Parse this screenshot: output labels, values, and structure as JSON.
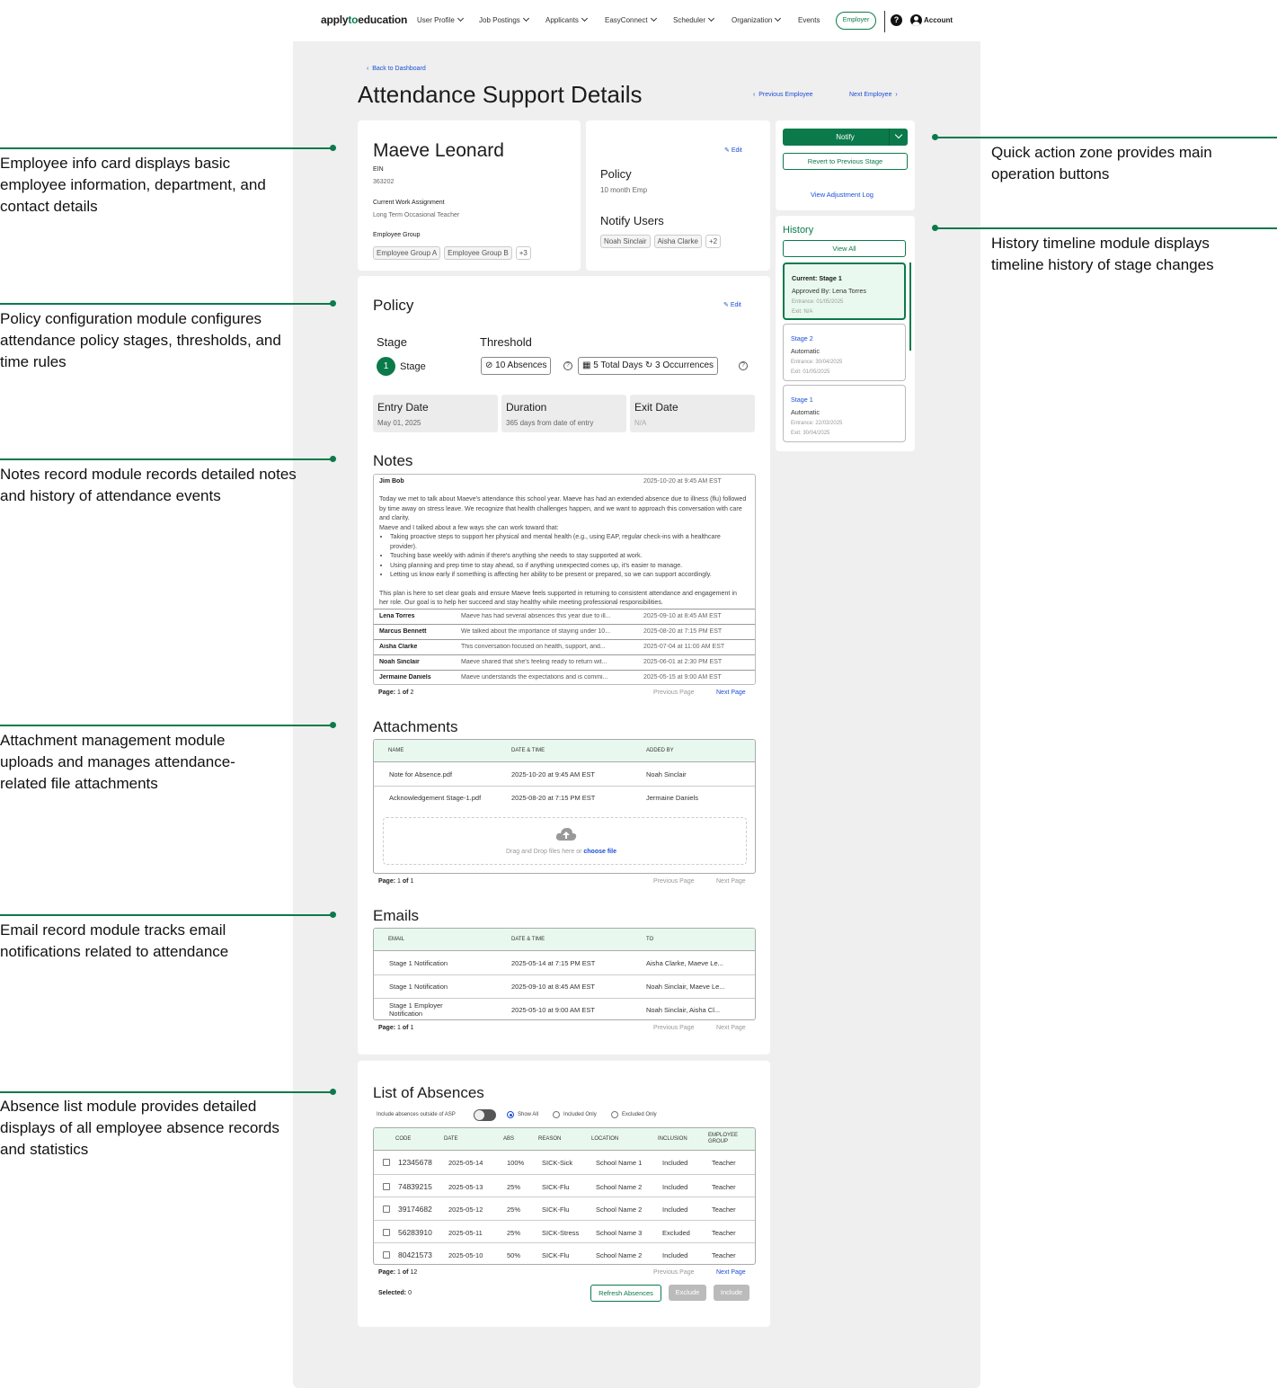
{
  "nav": {
    "brand_pre": "apply",
    "brand_to": "to",
    "brand_post": "education",
    "items": [
      "User Profile",
      "Job Postings",
      "Applicants",
      "EasyConnect",
      "Scheduler",
      "Organization",
      "Events"
    ],
    "employer": "Employer",
    "help": "?",
    "account": "Account"
  },
  "header": {
    "back": "Back to Dashboard",
    "title": "Attendance Support Details",
    "prev": "Previous Employee",
    "next": "Next Employee"
  },
  "employee": {
    "name": "Maeve Leonard",
    "ein_label": "EIN",
    "ein": "363202",
    "assign_label": "Current Work Assignment",
    "assign": "Long Term Occasional Teacher",
    "group_label": "Employee Group",
    "groups": [
      "Employee Group A",
      "Employee Group B"
    ],
    "more": "+3"
  },
  "policy_card": {
    "edit": "Edit",
    "policy_label": "Policy",
    "policy": "10 month Emp",
    "notify_label": "Notify Users",
    "users": [
      "Noah Sinclair",
      "Aisha Clarke"
    ],
    "more": "+2"
  },
  "policy": {
    "title": "Policy",
    "edit": "Edit",
    "stage_label": "Stage",
    "stage_num": "1",
    "stage_text": "Stage",
    "threshold_label": "Threshold",
    "absences": "10 Absences",
    "days": "5 Total Days",
    "occ": "3 Occurrences",
    "entry_label": "Entry Date",
    "entry": "May 01, 2025",
    "duration_label": "Duration",
    "duration": "365 days from date of entry",
    "exit_label": "Exit Date",
    "exit": "N/A"
  },
  "notes": {
    "title": "Notes",
    "first": {
      "author": "Jim Bob",
      "date": "2025-10-20 at 9:45 AM EST",
      "p1": "Today we met to talk about Maeve's attendance this school year. Maeve has had an extended absence due to illness (flu) followed by time away on stress leave. We recognize that health challenges happen, and we want to approach this conversation with care and clarity.",
      "p2": "Maeve and I talked about a few ways she can work toward that:",
      "bullets": [
        "Taking proactive steps to support her physical and mental health (e.g., using EAP, regular check-ins with a healthcare provider).",
        "Touching base weekly with admin if there's anything she needs to stay supported at work.",
        "Using planning and prep time to stay ahead, so if anything unexpected comes up, it's easier to manage.",
        "Letting us know early if something is affecting her ability to be present or prepared, so we can support accordingly."
      ],
      "p3": "This plan is here to set clear goals and ensure Maeve feels supported in returning to consistent attendance and engagement in her role. Our goal is to help her succeed and stay healthy while meeting professional responsibilities."
    },
    "rows": [
      {
        "name": "Lena Torres",
        "text": "Maeve has had several absences this year due to ill...",
        "date": "2025-09-10 at 8:45 AM EST"
      },
      {
        "name": "Marcus Bennett",
        "text": "We talked about the importance of staying under 10...",
        "date": "2025-08-20 at 7:15 PM EST"
      },
      {
        "name": "Aisha Clarke",
        "text": "This conversation focused on health, support, and...",
        "date": "2025-07-04 at 11:00 AM EST"
      },
      {
        "name": "Noah Sinclair",
        "text": "Maeve shared that she's feeling ready to return wit...",
        "date": "2025-06-01 at 2:30 PM EST"
      },
      {
        "name": "Jermaine Daniels",
        "text": "Maeve understands the expectations and is commi...",
        "date": "2025-05-15 at 9:00 AM EST"
      }
    ],
    "page_label": "Page:",
    "page": "1",
    "of": "of",
    "total": "2",
    "prev": "Previous Page",
    "next": "Next Page"
  },
  "attachments": {
    "title": "Attachments",
    "cols": [
      "NAME",
      "DATE & TIME",
      "ADDED BY"
    ],
    "rows": [
      {
        "name": "Note for Absence.pdf",
        "date": "2025-10-20 at 9:45 AM EST",
        "by": "Noah Sinclair"
      },
      {
        "name": "Acknowledgement Stage-1.pdf",
        "date": "2025-08-20 at 7:15 PM EST",
        "by": "Jermaine Daniels"
      }
    ],
    "drop": "Drag and Drop files here or",
    "choose": "choose file",
    "page_label": "Page:",
    "page": "1",
    "of": "of",
    "total": "1",
    "prev": "Previous Page",
    "next": "Next Page"
  },
  "emails": {
    "title": "Emails",
    "cols": [
      "EMAIL",
      "DATE & TIME",
      "TO"
    ],
    "rows": [
      {
        "name": "Stage 1 Notification",
        "date": "2025-05-14 at 7:15 PM EST",
        "to": "Aisha Clarke, Maeve Le..."
      },
      {
        "name": "Stage 1 Notification",
        "date": "2025-09-10 at 8:45 AM EST",
        "to": "Noah Sinclair, Maeve Le..."
      },
      {
        "name": "Stage 1 Employer Notification",
        "date": "2025-05-10 at 9:00 AM EST",
        "to": "Noah Sinclair, Aisha Cl..."
      }
    ],
    "page_label": "Page:",
    "page": "1",
    "of": "of",
    "total": "1",
    "prev": "Previous Page",
    "next": "Next Page"
  },
  "absences": {
    "title": "List of Absences",
    "toggle_label": "Include absences outside of ASP",
    "show_all": "Show All",
    "included_only": "Included Only",
    "excluded_only": "Excluded Only",
    "cols": [
      "CODE",
      "DATE",
      "ABS",
      "REASON",
      "LOCATION",
      "INCLUSION",
      "EMPLOYEE GROUP"
    ],
    "rows": [
      {
        "code": "12345678",
        "date": "2025-05-14",
        "abs": "100%",
        "reason": "SICK-Sick",
        "loc": "School Name 1",
        "inc": "Included",
        "grp": "Teacher"
      },
      {
        "code": "74839215",
        "date": "2025-05-13",
        "abs": "25%",
        "reason": "SICK-Flu",
        "loc": "School Name 2",
        "inc": "Included",
        "grp": "Teacher"
      },
      {
        "code": "39174682",
        "date": "2025-05-12",
        "abs": "25%",
        "reason": "SICK-Flu",
        "loc": "School Name 2",
        "inc": "Included",
        "grp": "Teacher"
      },
      {
        "code": "56283910",
        "date": "2025-05-11",
        "abs": "25%",
        "reason": "SICK-Stress",
        "loc": "School Name 3",
        "inc": "Excluded",
        "grp": "Teacher"
      },
      {
        "code": "80421573",
        "date": "2025-05-10",
        "abs": "50%",
        "reason": "SICK-Flu",
        "loc": "School Name 2",
        "inc": "Included",
        "grp": "Teacher"
      }
    ],
    "page_label": "Page:",
    "page": "1",
    "of": "of",
    "total": "12",
    "prev": "Previous Page",
    "next": "Next Page",
    "selected_label": "Selected:",
    "selected": "0",
    "refresh": "Refresh Absences",
    "exclude": "Exclude",
    "include": "Include"
  },
  "actions": {
    "notify": "Notify",
    "revert": "Revert to Previous Stage",
    "log": "View Adjustment Log"
  },
  "history": {
    "title": "History",
    "view_all": "View All",
    "items": [
      {
        "a": "Current: Stage 1",
        "b": "Approved By: Lena Torres",
        "c": "Entrance: 01/05/2025",
        "d": "Exit: N/A"
      },
      {
        "a": "Stage 2",
        "b": "Automatic",
        "c": "Entrance: 30/04/2025",
        "d": "Exit: 01/05/2025"
      },
      {
        "a": "Stage 1",
        "b": "Automatic",
        "c": "Entrance: 22/03/2025",
        "d": "Exit: 30/04/2025"
      }
    ]
  },
  "annotations": [
    "Employee info card displays basic employee information, department, and contact details",
    "Policy configuration module configures attendance policy stages, thresholds, and time rules",
    "Notes record module records detailed notes and history of attendance events",
    "Attachment management module uploads and manages attendance-related file attachments",
    "Email record module tracks email notifications related to attendance",
    "Absence list module provides detailed displays of all employee absence records and statistics",
    "Quick action zone provides main operation buttons",
    "History timeline module displays timeline history of stage changes"
  ],
  "colors": {
    "accent": "#0b7a4b",
    "link": "#1a4fd6",
    "table_header": "#e8f8ee"
  }
}
